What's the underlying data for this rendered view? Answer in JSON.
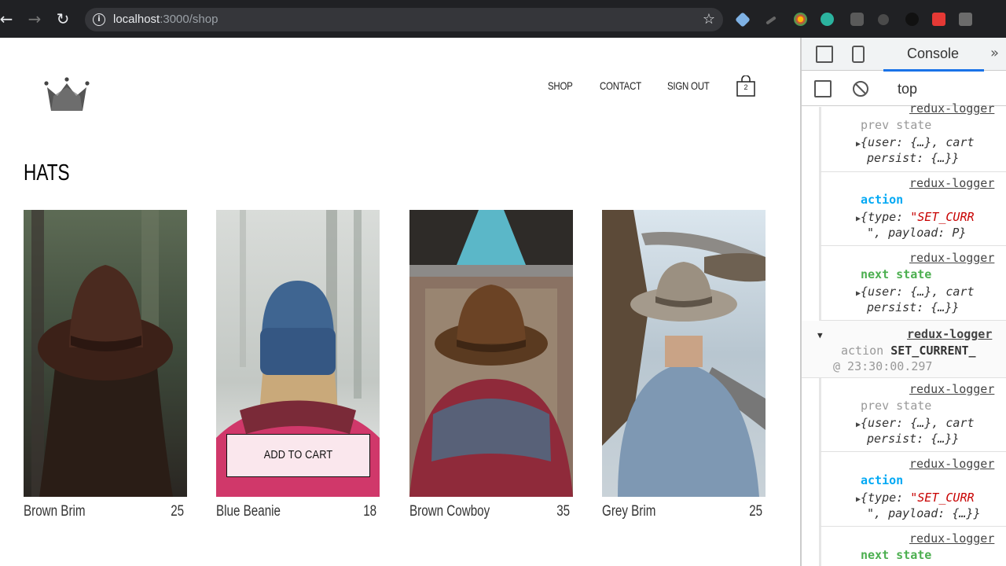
{
  "browser": {
    "url_host": "localhost",
    "url_path": ":3000/shop"
  },
  "nav": {
    "shop": "SHOP",
    "contact": "CONTACT",
    "signout": "SIGN OUT",
    "cart_count": "2"
  },
  "collection": {
    "title": "HATS",
    "items": [
      {
        "name": "Brown Brim",
        "price": "25"
      },
      {
        "name": "Blue Beanie",
        "price": "18"
      },
      {
        "name": "Brown Cowboy",
        "price": "35"
      },
      {
        "name": "Grey Brim",
        "price": "25"
      }
    ],
    "add_to_cart": "ADD TO CART"
  },
  "devtools": {
    "tab": "Console",
    "context": "top",
    "logs": {
      "logger": "redux-logger",
      "prev_state": "prev state",
      "action": "action",
      "next_state": "next state",
      "state_line1": "{user: {…}, cart",
      "state_line2": "persist: {…}}",
      "state_line2_b": "persist: {…}}",
      "action_type_label": "{type: ",
      "action_type_value": "\"SET_CURR",
      "payload_p": "\", payload: P}",
      "payload_obj": "\", payload: {…}}",
      "group_action_label": "action",
      "group_action_value": "SET_CURRENT_",
      "group_time": "@ 23:30:00.297"
    }
  },
  "colors": {
    "action": "#03a9f4",
    "next_state": "#4caf50",
    "prev_state": "#9e9e9e",
    "string": "#c80000"
  }
}
